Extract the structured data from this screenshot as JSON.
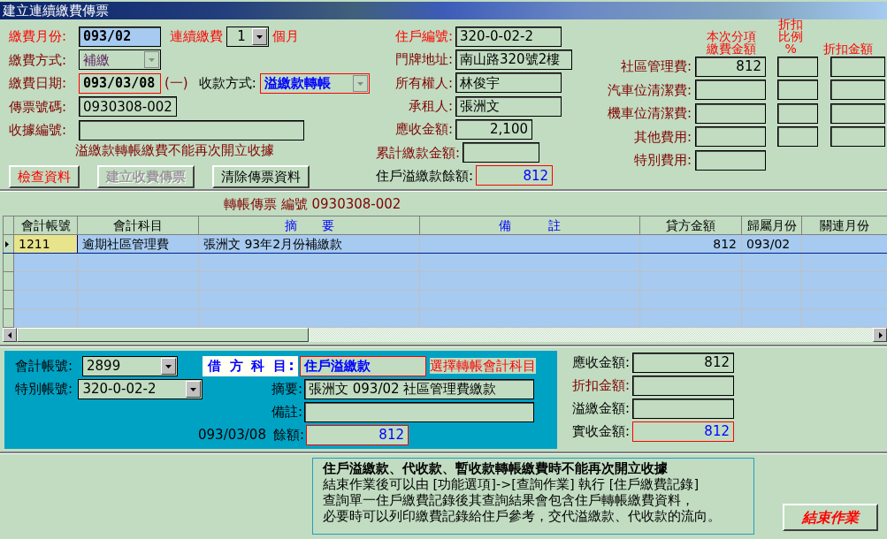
{
  "window": {
    "title": "建立連續繳費傳票"
  },
  "payment_month": {
    "label": "繳費月份:",
    "value": "093/02"
  },
  "consecutive": {
    "label": "連續繳費",
    "value": "1",
    "unit": "個月"
  },
  "payment_method": {
    "label": "繳費方式:",
    "value": "補繳"
  },
  "payment_date": {
    "label": "繳費日期:",
    "value": "093/03/08",
    "weekday": "(一)"
  },
  "collection_method": {
    "label": "收款方式:",
    "value": "溢繳款轉帳"
  },
  "voucher_no": {
    "label": "傳票號碼:",
    "value": "0930308-002"
  },
  "receipt_no": {
    "label": "收據編號:"
  },
  "receipt_warning": "溢繳款轉帳繳費不能再次開立收據",
  "buttons": [
    {
      "label": "檢查資料",
      "kind": "alert",
      "disabled": false
    },
    {
      "label": "建立收費傳票",
      "kind": "normal",
      "disabled": true
    },
    {
      "label": "清除傳票資料",
      "kind": "normal",
      "disabled": false
    }
  ],
  "household": [
    {
      "label": "住戶編號:",
      "value": "320-0-02-2",
      "kind": "key"
    },
    {
      "label": "門牌地址:",
      "value": "南山路320號2樓",
      "kind": "normal"
    },
    {
      "label": "所有權人:",
      "value": "林俊宇",
      "kind": "normal"
    },
    {
      "label": "承租人:",
      "value": "張洲文",
      "kind": "normal"
    },
    {
      "label": "應收金額:",
      "value": "2,100",
      "kind": "normal"
    },
    {
      "label": "累計繳款金額:",
      "kind": "normal"
    },
    {
      "label": "住戶溢繳款餘額:",
      "value": "812",
      "kind": "balance"
    }
  ],
  "fee_headers": [
    "本次分項繳費金額",
    "折扣比例 %",
    "折扣金額"
  ],
  "fees": [
    {
      "label": "社區管理費:",
      "amount": "812",
      "has_discount": true
    },
    {
      "label": "汽車位清潔費:",
      "has_discount": true
    },
    {
      "label": "機車位清潔費:",
      "has_discount": true
    },
    {
      "label": "其他費用:",
      "has_discount": true
    },
    {
      "label": "特別費用:",
      "has_discount": false
    }
  ],
  "grid": {
    "title": "轉帳傳票 編號 0930308-002",
    "columns": [
      {
        "label": "會計帳號",
        "kind": "normal"
      },
      {
        "label": "會計科目",
        "kind": "normal"
      },
      {
        "label": "摘　　要",
        "kind": "blue"
      },
      {
        "label": "備　　　註",
        "kind": "blue"
      },
      {
        "label": "貸方金額",
        "kind": "normal"
      },
      {
        "label": "歸屬月份",
        "kind": "normal"
      },
      {
        "label": "關連月份",
        "kind": "normal"
      }
    ],
    "rows": [
      {
        "cells": [
          "1211",
          "逾期社區管理費",
          "張洲文  93年2月份補繳款",
          null,
          "812",
          "093/02",
          null
        ],
        "selected": true
      }
    ]
  },
  "transfer": {
    "account": {
      "label": "會計帳號:",
      "value": "2899"
    },
    "special": {
      "label": "特別帳號:",
      "value": "320-0-02-2"
    },
    "debit": {
      "label": "借 方 科 目:",
      "value": "住戶溢繳款"
    },
    "hint": "選擇轉帳會計科目",
    "summary": {
      "label": "摘要:",
      "value": "張洲文 093/02 社區管理費繳款"
    },
    "remark": {
      "label": "備註:"
    },
    "date": "093/03/08",
    "balance": {
      "label": "餘額:",
      "value": "812"
    }
  },
  "totals": [
    {
      "label": "應收金額:",
      "value": "812",
      "kind": "normal"
    },
    {
      "label": "折扣金額:",
      "kind": "discount"
    },
    {
      "label": "溢繳金額:",
      "kind": "normal"
    },
    {
      "label": "實收金額:",
      "value": "812",
      "kind": "total"
    }
  ],
  "note": {
    "heading": "住戶溢繳款、代收款、暫收款轉帳繳費時不能再次開立收據",
    "lines": [
      "結束作業後可以由 [功能選項]->[查詢作業] 執行 [住戶繳費記錄]",
      "查詢單一住戶繳費記錄後其查詢結果會包含住戶轉帳繳費資料，",
      "必要時可以列印繳費記錄給住戶參考，交代溢繳款、代收款的流向。"
    ]
  },
  "end_button": {
    "label": "結束作業"
  }
}
